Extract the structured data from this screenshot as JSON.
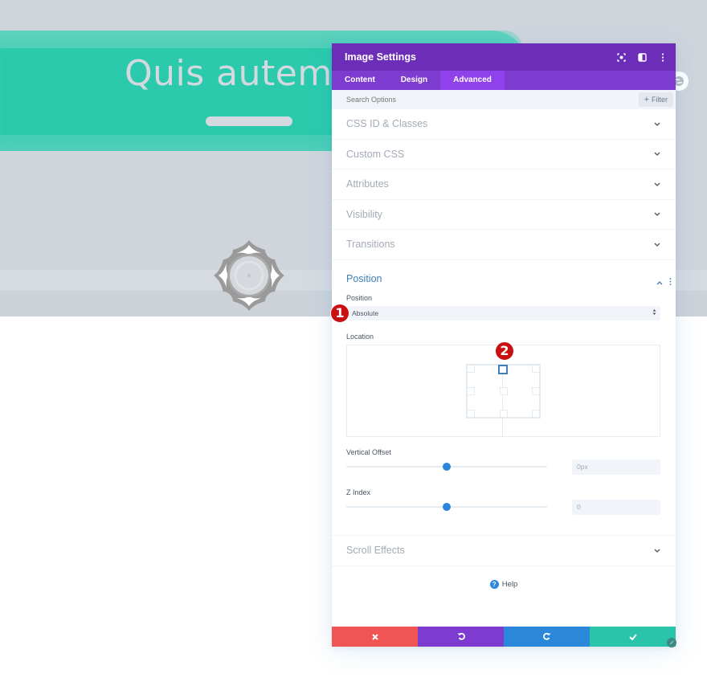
{
  "background": {
    "hero_title": "Quis autem v",
    "colors": {
      "page_bg": "#d0d5dc",
      "brush": "#2bcaad",
      "hero_text": "#d4d9df"
    }
  },
  "panel": {
    "title": "Image Settings",
    "header_icons": [
      "fullscreen-icon",
      "split-view-icon",
      "more-options-icon"
    ],
    "tabs": [
      {
        "label": "Content",
        "active": false
      },
      {
        "label": "Design",
        "active": false
      },
      {
        "label": "Advanced",
        "active": true
      }
    ],
    "search": {
      "placeholder": "Search Options",
      "value": ""
    },
    "filter_label": "Filter",
    "sections": [
      {
        "label": "CSS ID & Classes",
        "expanded": false
      },
      {
        "label": "Custom CSS",
        "expanded": false
      },
      {
        "label": "Attributes",
        "expanded": false
      },
      {
        "label": "Visibility",
        "expanded": false
      },
      {
        "label": "Transitions",
        "expanded": false
      }
    ],
    "position_section": {
      "title": "Position",
      "expanded": true,
      "position_label": "Position",
      "position_value": "Absolute",
      "location_label": "Location",
      "location_selected": "top-center",
      "vertical_offset_label": "Vertical Offset",
      "vertical_offset_value": "0px",
      "vertical_offset_slider_percent": 50,
      "z_index_label": "Z Index",
      "z_index_value": "0",
      "z_index_slider_percent": 50
    },
    "scroll_effects": {
      "label": "Scroll Effects",
      "expanded": false
    },
    "help_label": "Help",
    "footer_buttons": [
      {
        "name": "cancel",
        "icon": "close-icon",
        "color": "#ef5555"
      },
      {
        "name": "undo",
        "icon": "undo-icon",
        "color": "#7e3bd0"
      },
      {
        "name": "redo",
        "icon": "redo-icon",
        "color": "#2b87da"
      },
      {
        "name": "save",
        "icon": "check-icon",
        "color": "#29c4a9"
      }
    ],
    "colors": {
      "header": "#6c2eb9",
      "tabs": "#7e3bd0",
      "active_tab": "#8f42ec",
      "accent_blue": "#2b87da",
      "section_title_active": "#3f7fb5"
    }
  },
  "annotations": [
    {
      "number": "1",
      "target": "position-select"
    },
    {
      "number": "2",
      "target": "location-top-center"
    }
  ]
}
